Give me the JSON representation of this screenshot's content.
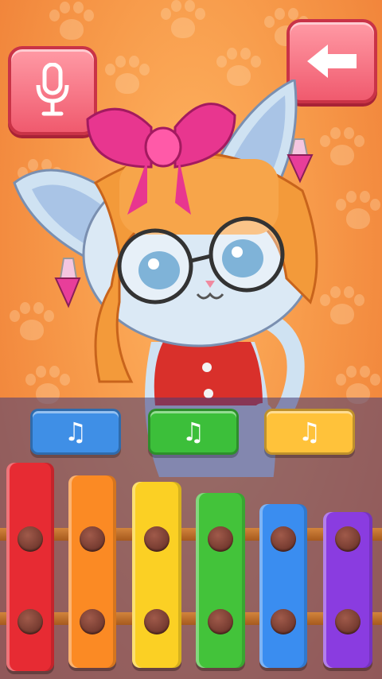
{
  "game": {
    "icons": {
      "mic": "microphone-icon",
      "back": "back-arrow-icon",
      "note": "music-note-icon"
    },
    "note_buttons": [
      {
        "label": "♫",
        "color": "#3f8fe6"
      },
      {
        "label": "♫",
        "color": "#3cbf3a"
      },
      {
        "label": "♫",
        "color": "#ffc23a"
      }
    ],
    "xylophone_keys": [
      {
        "color": "#e72b33"
      },
      {
        "color": "#fb8a24"
      },
      {
        "color": "#fbd024"
      },
      {
        "color": "#43c33a"
      },
      {
        "color": "#3a8df0"
      },
      {
        "color": "#8a3ce0"
      }
    ],
    "colors": {
      "background": "#f79a4a",
      "button_pink": "#f05a6e",
      "panel": "#463c78"
    }
  }
}
